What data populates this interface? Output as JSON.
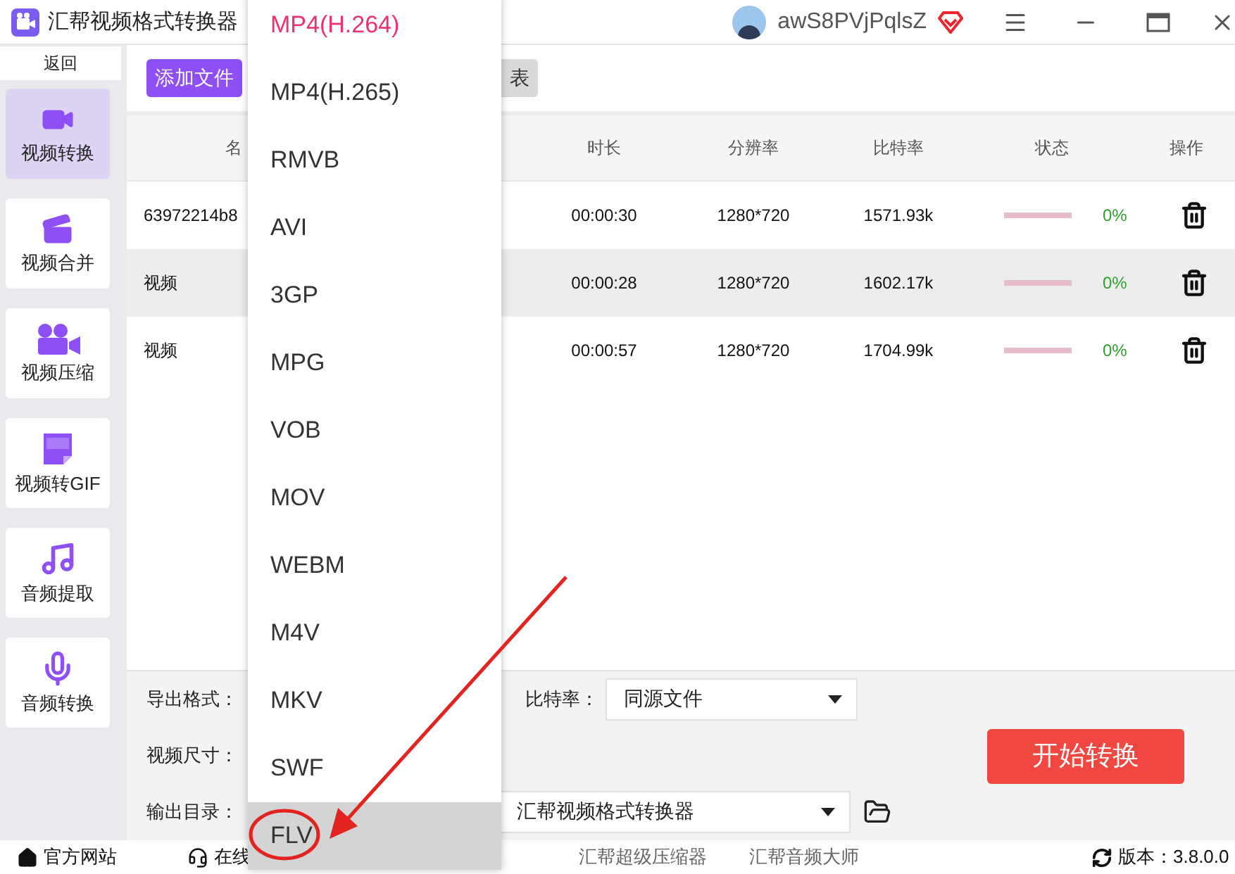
{
  "window": {
    "title": "汇帮视频格式转换器",
    "user": "awS8PVjPqlsZ"
  },
  "sidebar": {
    "back": "返回",
    "items": [
      {
        "label": "视频转换",
        "kind": "convert",
        "selected": true
      },
      {
        "label": "视频合并",
        "kind": "merge",
        "selected": false
      },
      {
        "label": "视频压缩",
        "kind": "compress",
        "selected": false
      },
      {
        "label": "视频转GIF",
        "kind": "gif",
        "selected": false
      },
      {
        "label": "音频提取",
        "kind": "music",
        "selected": false
      },
      {
        "label": "音频转换",
        "kind": "mic",
        "selected": false
      }
    ]
  },
  "toolbar": {
    "buttons": [
      {
        "label": "添加文件",
        "kind": "primary"
      },
      {
        "label": "表",
        "kind": "secondary"
      }
    ]
  },
  "table": {
    "columns": [
      "名",
      "时长",
      "分辨率",
      "比特率",
      "状态",
      "操作"
    ],
    "rows": [
      {
        "name": "63972214b8",
        "duration": "00:00:30",
        "resolution": "1280*720",
        "bitrate": "1571.93k",
        "level": 0,
        "progress": "0%",
        "selected": false
      },
      {
        "name": "视频",
        "duration": "00:00:28",
        "resolution": "1280*720",
        "bitrate": "1602.17k",
        "level": 0,
        "progress": "0%",
        "selected": true
      },
      {
        "name": "视频",
        "duration": "00:00:57",
        "resolution": "1280*720",
        "bitrate": "1704.99k",
        "level": 0,
        "progress": "0%",
        "selected": false
      }
    ]
  },
  "settings": {
    "format_label": "导出格式：",
    "size_label": "视频尺寸：",
    "output_label": "输出目录：",
    "bitrate_label": "比特率：",
    "bitrate_value": "同源文件",
    "output_value": "汇帮视频格式转换器",
    "start_button": "开始转换"
  },
  "format_menu": {
    "items": [
      {
        "label": "MP4(H.264)",
        "selected": true,
        "highlighted": false
      },
      {
        "label": "MP4(H.265)",
        "selected": false,
        "highlighted": false
      },
      {
        "label": "RMVB",
        "selected": false,
        "highlighted": false
      },
      {
        "label": "AVI",
        "selected": false,
        "highlighted": false
      },
      {
        "label": "3GP",
        "selected": false,
        "highlighted": false
      },
      {
        "label": "MPG",
        "selected": false,
        "highlighted": false
      },
      {
        "label": "VOB",
        "selected": false,
        "highlighted": false
      },
      {
        "label": "MOV",
        "selected": false,
        "highlighted": false
      },
      {
        "label": "WEBM",
        "selected": false,
        "highlighted": false
      },
      {
        "label": "M4V",
        "selected": false,
        "highlighted": false
      },
      {
        "label": "MKV",
        "selected": false,
        "highlighted": false
      },
      {
        "label": "SWF",
        "selected": false,
        "highlighted": false
      },
      {
        "label": "FLV",
        "selected": false,
        "highlighted": true
      }
    ]
  },
  "footer": {
    "links": [
      {
        "label": "官方网站",
        "kind": "home"
      },
      {
        "label": "在线",
        "kind": "support"
      },
      {
        "label": "汇帮超级压缩器",
        "kind": "text"
      },
      {
        "label": "汇帮音频大师",
        "kind": "text"
      }
    ],
    "version": "版本：3.8.0.0"
  }
}
